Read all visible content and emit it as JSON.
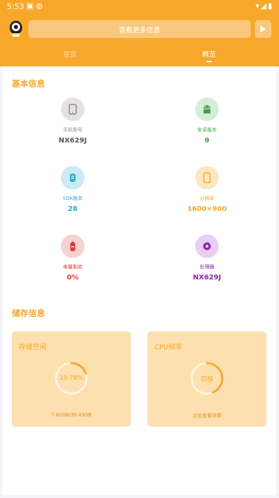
{
  "status_bar": {
    "time": "5:53"
  },
  "header": {
    "search_button_label": "查看更多信息",
    "tabs": [
      {
        "label": "总览",
        "active": false
      },
      {
        "label": "概览",
        "active": true
      }
    ]
  },
  "basic_info": {
    "title": "基本信息",
    "items": [
      {
        "label": "手机型号",
        "value": "NX629J",
        "icon": "phone-icon",
        "color": "#8c8c8c",
        "bg": "#e6e2e1"
      },
      {
        "label": "安卓版本",
        "value": "9",
        "icon": "android-icon",
        "color": "#43a047",
        "bg": "#d6edd8"
      },
      {
        "label": "SDK版本",
        "value": "28",
        "icon": "sdk-icon",
        "color": "#29a8d8",
        "bg": "#cbeaf6"
      },
      {
        "label": "分辨率",
        "value": "1600×900",
        "icon": "screen-icon",
        "color": "#f7a82a",
        "bg": "#fde7c4"
      },
      {
        "label": "电量剩余",
        "value": "0%",
        "icon": "battery-icon",
        "color": "#e53935",
        "bg": "#f8d2d2"
      },
      {
        "label": "处理器",
        "value": "NX629J",
        "icon": "cpu-icon",
        "color": "#8e24aa",
        "bg": "#e6cff0"
      }
    ]
  },
  "storage_info": {
    "title": "储存信息",
    "storage_card": {
      "title": "存储空间",
      "percent_label": "19.78%",
      "percent": 19.78,
      "footer": "7.80GB/39.43GB"
    },
    "cpu_card": {
      "title": "CPU频率",
      "center_label": "四核",
      "footer": "点击查看详情"
    }
  },
  "colors": {
    "accent": "#f7a82a",
    "card_bg": "#fde0b0"
  }
}
